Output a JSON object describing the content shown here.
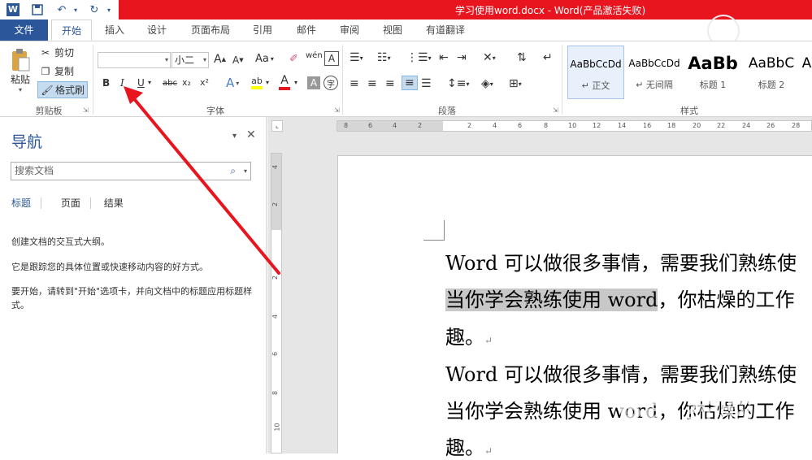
{
  "window": {
    "title": "学习使用word.docx -  Word(产品激活失败)",
    "accent": "#e8141e",
    "brand": "#2b579a"
  },
  "qat": {
    "word_icon": "W",
    "save_icon": "save-icon",
    "undo_icon": "undo-icon",
    "redo_icon": "redo-icon"
  },
  "tabs": [
    {
      "label": "文件"
    },
    {
      "label": "开始"
    },
    {
      "label": "插入"
    },
    {
      "label": "设计"
    },
    {
      "label": "页面布局"
    },
    {
      "label": "引用"
    },
    {
      "label": "邮件"
    },
    {
      "label": "审阅"
    },
    {
      "label": "视图"
    },
    {
      "label": "有道翻译"
    }
  ],
  "clipboard": {
    "paste": "粘贴",
    "cut": "剪切",
    "copy": "复制",
    "format_painter": "格式刷",
    "group": "剪贴板"
  },
  "font": {
    "font_name": "",
    "font_size": "小二",
    "grow": "A",
    "shrink": "A",
    "change_case": "Aa",
    "group": "字体",
    "bold": "B",
    "italic": "I",
    "underline": "U",
    "strike": "abc",
    "subscript": "x₂",
    "superscript": "x²",
    "text_effects": "A",
    "highlight": "ab",
    "font_color": "A",
    "char_shading": "A",
    "enclose": "字"
  },
  "paragraph": {
    "group": "段落"
  },
  "styles": {
    "group": "样式",
    "items": [
      {
        "preview": "AaBbCcDd",
        "name": "↵ 正文"
      },
      {
        "preview": "AaBbCcDd",
        "name": "↵ 无间隔"
      },
      {
        "preview": "AaBb",
        "name": "标题 1"
      },
      {
        "preview": "AaBbC",
        "name": "标题 2"
      },
      {
        "preview": "A",
        "name": ""
      }
    ]
  },
  "nav": {
    "title": "导航",
    "search_placeholder": "搜索文档",
    "tabs": [
      "标题",
      "页面",
      "结果"
    ],
    "msg1": "创建文档的交互式大纲。",
    "msg2": "它是跟踪您的具体位置或快速移动内容的好方式。",
    "msg3": "要开始，请转到\"开始\"选项卡，并向文档中的标题应用标题样式。"
  },
  "ruler": {
    "h_ticks": [
      "8",
      "6",
      "4",
      "2",
      "2",
      "4",
      "6",
      "8",
      "10",
      "12",
      "14",
      "16",
      "18",
      "20",
      "22",
      "24",
      "26",
      "28"
    ],
    "v_ticks": [
      "4",
      "2",
      "2",
      "4",
      "6",
      "8",
      "10"
    ]
  },
  "document": {
    "line1": "Word 可以做很多事情，需要我们熟练使",
    "line2_hl": "当你学会熟练使用 word",
    "line2_rest": "，你枯燥的工作",
    "line3": "趣。",
    "line4": "Word 可以做很多事情，需要我们熟练使",
    "line5": "当你学会熟练使用 word，你枯燥的工作",
    "line6": "趣。",
    "return_mark": "↵"
  },
  "watermark": {
    "logo": "Bai 经验",
    "url": "jingyan.baidu.com"
  }
}
